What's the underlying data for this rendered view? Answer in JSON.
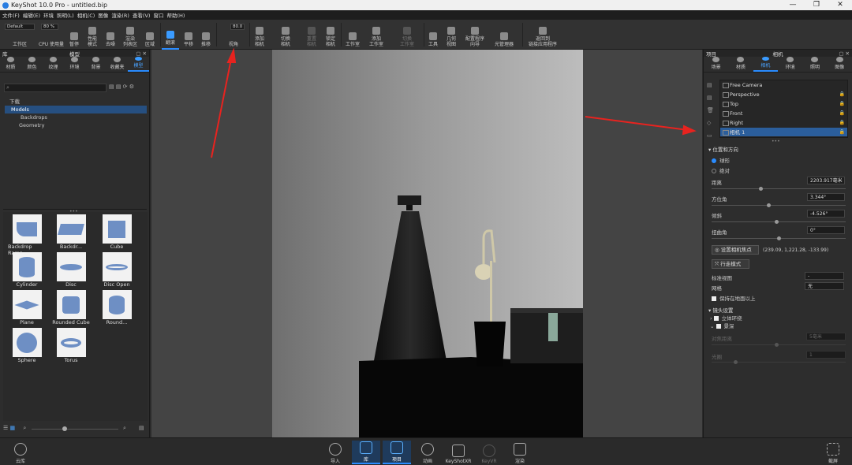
{
  "window": {
    "title": "KeyShot 10.0 Pro - untitled.bip"
  },
  "menu": [
    "文件(F)",
    "编辑(E)",
    "环境",
    "照明(L)",
    "相机(C)",
    "图像",
    "渲染(R)",
    "查看(V)",
    "窗口",
    "帮助(H)"
  ],
  "toolbar": {
    "workspace_select": "Default",
    "zoom_value": "80 %",
    "fov_value": "80.0",
    "items": {
      "workspace": "工作区",
      "cpu": "CPU 使用量",
      "pause": "暂停",
      "perf_mode": "性能\n模式",
      "denoise": "去噪",
      "render_region": "渲染\n列表区",
      "region": "区域",
      "tumble": "翻滚",
      "pan": "平移",
      "dolly": "推移",
      "fov": "视角",
      "add_camera": "添加\n相机",
      "switch_camera": "切换\n相机",
      "reset_camera": "重置\n相机",
      "lock_camera": "锁定\n相机",
      "studio": "工作室",
      "add_studio": "添加\n工作室",
      "switch_studio": "切换\n工作室",
      "tools": "工具",
      "geometry_view": "几何\n视图",
      "config_program": "配置程序\n向导",
      "light_manager": "光管理器",
      "back_to_app": "返回到\n链接应用程序"
    }
  },
  "library": {
    "panel_title": "库",
    "sub_title": "模型",
    "tabs": [
      "材质",
      "颜色",
      "纹理",
      "环境",
      "背景",
      "收藏夹",
      "模型"
    ],
    "active_tab": 6,
    "tree": [
      "下载",
      "Models",
      "Backdrops",
      "Geometry"
    ],
    "items": [
      "Backdrop Ramp",
      "Backdr...",
      "Cube",
      "Cylinder",
      "Disc",
      "Disc Open",
      "Plane",
      "Rounded Cube",
      "Round...",
      "Sphere",
      "Torus"
    ]
  },
  "project": {
    "panel_title": "项目",
    "sub_title": "相机",
    "tabs": [
      "场景",
      "材质",
      "相机",
      "环境",
      "照明",
      "图像"
    ],
    "active_tab": 2,
    "cameras": [
      "Free Camera",
      "Perspective",
      "Top",
      "Front",
      "Right",
      "相机 1"
    ],
    "selected_camera": 5,
    "section_position": "位置和方向",
    "mode_spherical": "球形",
    "mode_absolute": "绝对",
    "distance_label": "距离",
    "distance_value": "2203.917毫米",
    "azimuth_label": "方位角",
    "azimuth_value": "3.344°",
    "inclination_label": "倾斜",
    "inclination_value": "-4.526°",
    "twist_label": "扭曲角",
    "twist_value": "0°",
    "set_focus_btn": "设置相机焦点",
    "focus_coords": "(239.09, 1,221.28, -133.99)",
    "walk_mode_btn": "行走模式",
    "standard_view_label": "标准视图",
    "standard_view_value": "-",
    "grid_label": "网格",
    "grid_value": "无",
    "keep_above_ground": "保持在地面以上",
    "lens_section": "镜头设置",
    "stereo": "立体环绕",
    "dof": "景深",
    "focus_distance_label": "对焦距离",
    "focus_distance_value": "5毫米",
    "aperture_label": "光圈",
    "aperture_value": "1"
  },
  "bottom": {
    "cloud": "云库",
    "import": "导入",
    "library": "库",
    "project": "项目",
    "animation": "动画",
    "keyshotxr": "KeyShotXR",
    "keyvr": "KeyVR",
    "render": "渲染",
    "screenshot": "截屏"
  }
}
